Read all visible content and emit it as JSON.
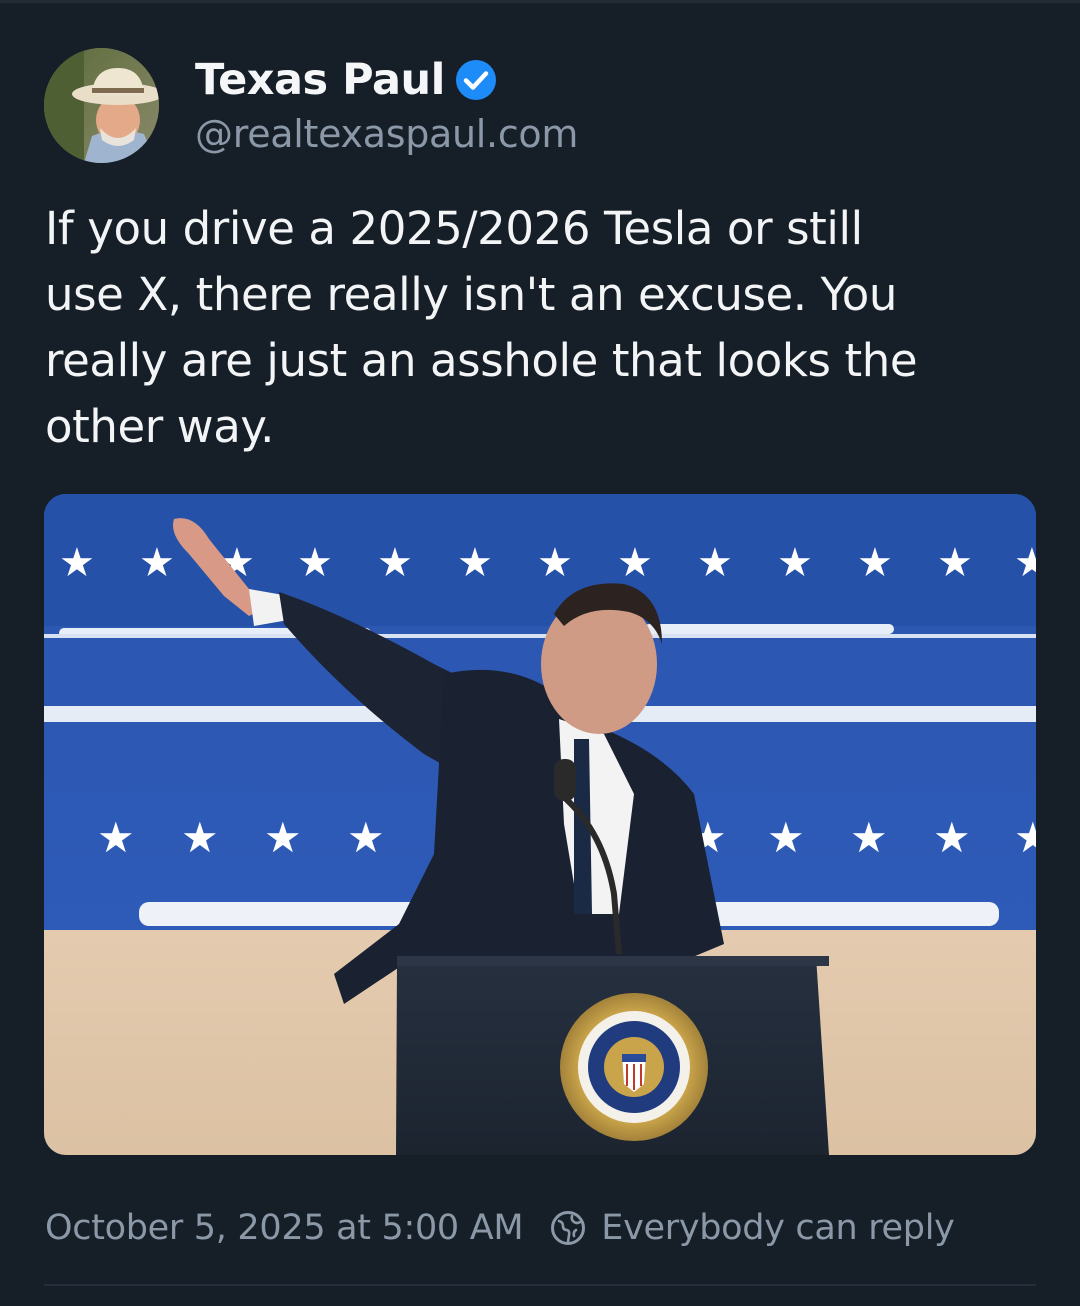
{
  "post": {
    "author": {
      "display_name": "Texas Paul",
      "handle": "@realtexaspaul.com",
      "verified_icon": "verified-check-icon",
      "avatar": "avatar"
    },
    "text": "If you drive a 2025/2026 Tesla or still\nuse X, there really isn't an excuse.  You\nreally are just an asshole that looks the\nother way.",
    "image": {
      "name": "embedded-photo"
    },
    "timestamp": "October 5, 2025 at 5:00 AM",
    "reply_setting_icon": "globe-reply-icon",
    "reply_setting": "Everybody can reply"
  },
  "colors": {
    "background": "#161e27",
    "text_primary": "#f2f4f6",
    "text_secondary": "#8b98a8",
    "verified": "#1d8cf8"
  }
}
